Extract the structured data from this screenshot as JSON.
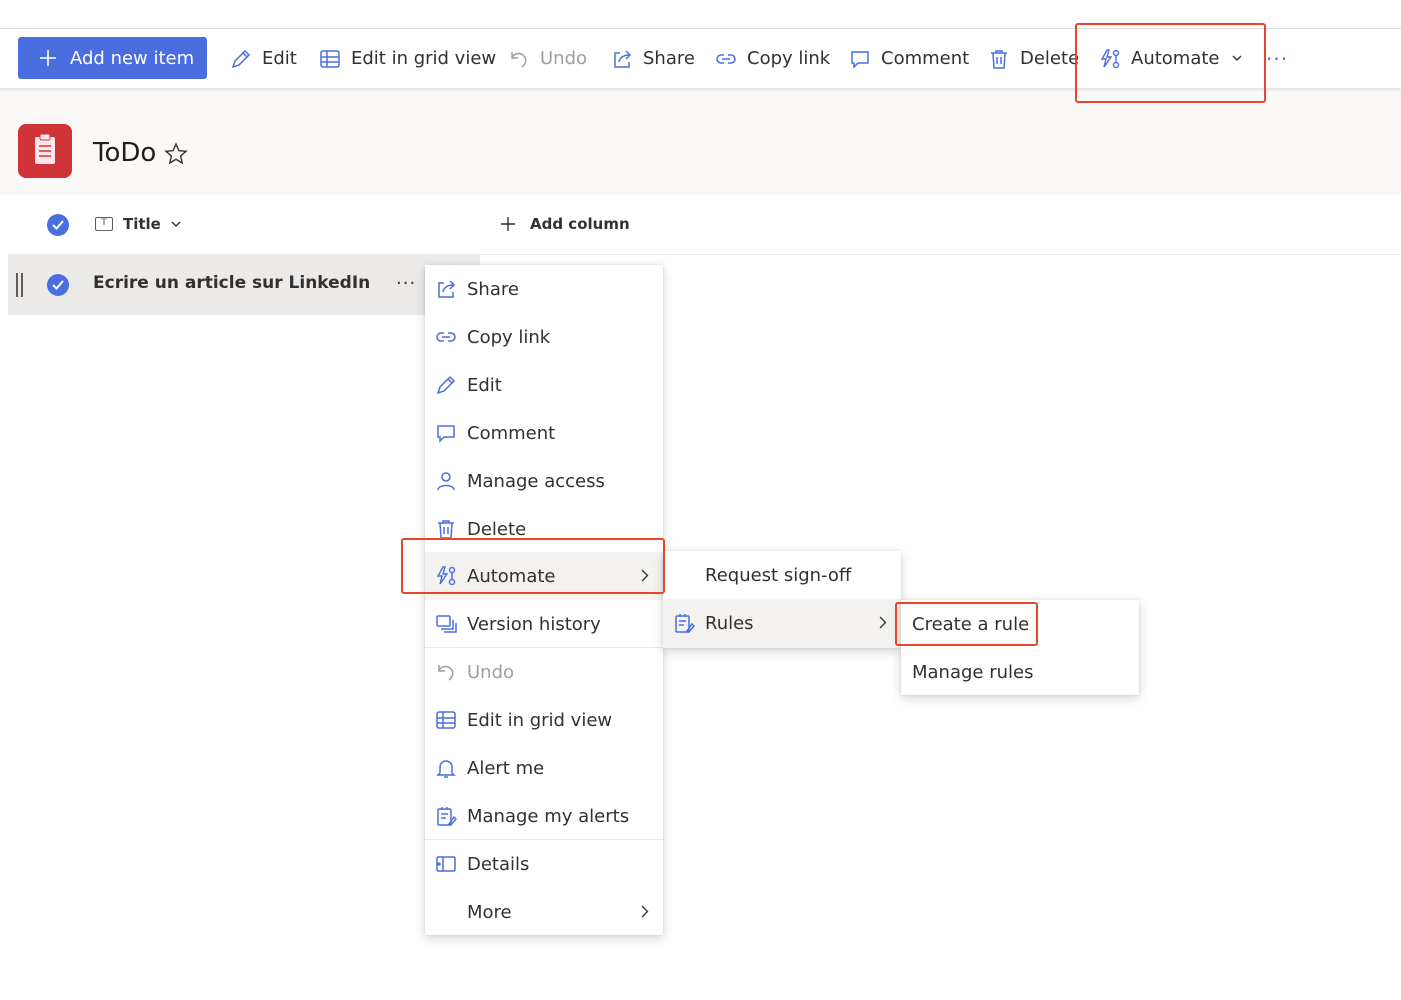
{
  "toolbar": {
    "add_new_item": "Add new item",
    "edit": "Edit",
    "edit_grid": "Edit in grid view",
    "undo": "Undo",
    "share": "Share",
    "copy_link": "Copy link",
    "comment": "Comment",
    "delete": "Delete",
    "automate": "Automate",
    "more": "···"
  },
  "list": {
    "title": "ToDo",
    "columns": {
      "title": "Title",
      "add_column": "Add column"
    },
    "rows": [
      {
        "title": "Ecrire un article sur LinkedIn"
      }
    ],
    "row_more": "···"
  },
  "context_menu": {
    "items": [
      "Share",
      "Copy link",
      "Edit",
      "Comment",
      "Manage access",
      "Delete",
      "Automate",
      "Version history",
      "Undo",
      "Edit in grid view",
      "Alert me",
      "Manage my alerts",
      "Details",
      "More"
    ]
  },
  "automate_submenu": {
    "items": [
      "Request sign-off",
      "Rules"
    ]
  },
  "rules_submenu": {
    "items": [
      "Create a rule",
      "Manage rules"
    ]
  },
  "colors": {
    "accent": "#4a6ee0",
    "list_icon": "#d13438",
    "highlight": "#e8452c"
  }
}
